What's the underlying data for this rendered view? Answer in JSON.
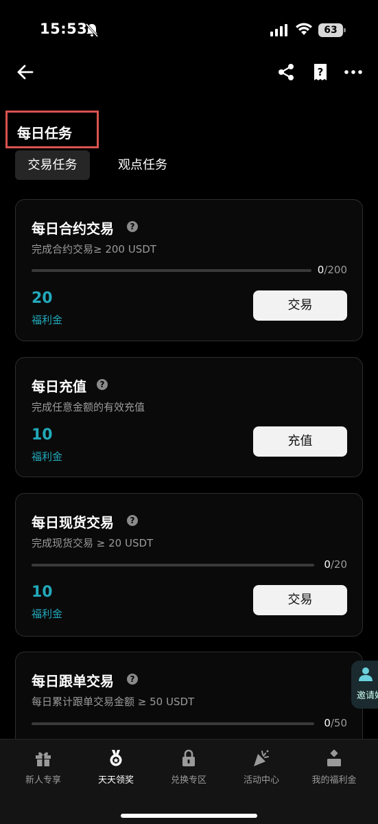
{
  "status": {
    "time": "15:53",
    "battery": "63"
  },
  "header": {
    "section_title": "每日任务"
  },
  "tabs": [
    {
      "label": "交易任务",
      "active": true
    },
    {
      "label": "观点任务",
      "active": false
    }
  ],
  "tasks": [
    {
      "title": "每日合约交易",
      "desc": "完成合约交易≥ 200 USDT",
      "progress_current": "0",
      "progress_total": "/200",
      "progress_fraction": 0,
      "reward": "20",
      "reward_label": "福利金",
      "button": "交易"
    },
    {
      "title": "每日充值",
      "desc": "完成任意金额的有效充值",
      "reward": "10",
      "reward_label": "福利金",
      "button": "充值"
    },
    {
      "title": "每日现货交易",
      "desc": "完成现货交易 ≥ 20 USDT",
      "progress_current": "0",
      "progress_total": "/20",
      "progress_fraction": 0,
      "reward": "10",
      "reward_label": "福利金",
      "button": "交易"
    },
    {
      "title": "每日跟单交易",
      "desc": "每日累计跟单交易金额 ≥ 50 USDT",
      "progress_current": "0",
      "progress_total": "/50",
      "progress_fraction": 0
    }
  ],
  "invite": {
    "label": "邀请好"
  },
  "tabbar": [
    {
      "label": "新人专享",
      "icon": "gift-icon",
      "active": false
    },
    {
      "label": "天天领奖",
      "icon": "medal-icon",
      "active": true
    },
    {
      "label": "兑换专区",
      "icon": "lock-bag-icon",
      "active": false
    },
    {
      "label": "活动中心",
      "icon": "party-popper-icon",
      "active": false
    },
    {
      "label": "我的福利金",
      "icon": "coin-stack-icon",
      "active": false
    }
  ],
  "colors": {
    "accent": "#22a9bb",
    "highlight_border": "#d9534f"
  }
}
